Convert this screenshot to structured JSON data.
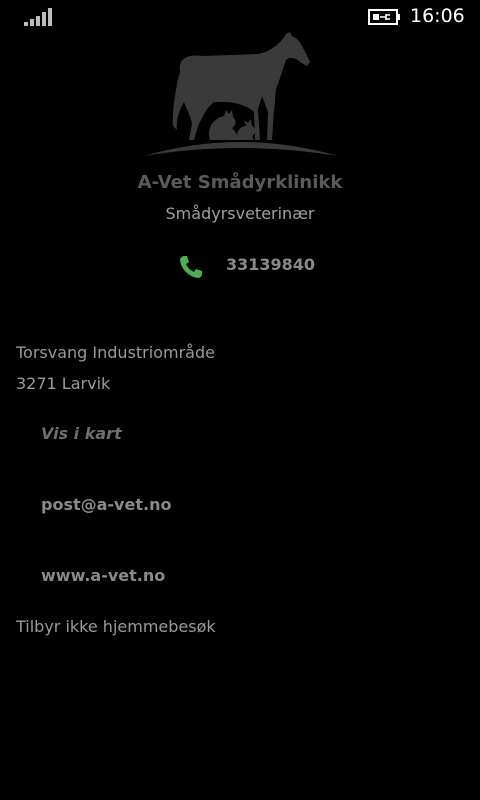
{
  "status_bar": {
    "time": "16:06",
    "signal_icon": "signal-strength-icon",
    "battery_icon": "battery-charging-icon"
  },
  "clinic": {
    "logo_icon": "horse-cat-logo-icon",
    "name": "A-Vet Smådyrklinikk",
    "subtitle": "Smådyrsveterinær"
  },
  "contact": {
    "phone_icon": "phone-icon",
    "phone": "33139840",
    "address_line1": "Torsvang Industriområde",
    "address_line2": "3271 Larvik",
    "map_link": "Vis i kart",
    "email": "post@a-vet.no",
    "website": "www.a-vet.no",
    "home_visit_note": "Tilbyr ikke hjemmebesøk"
  },
  "colors": {
    "background": "#000000",
    "phone_icon": "#4caf50",
    "logo": "#3a3a3a"
  }
}
